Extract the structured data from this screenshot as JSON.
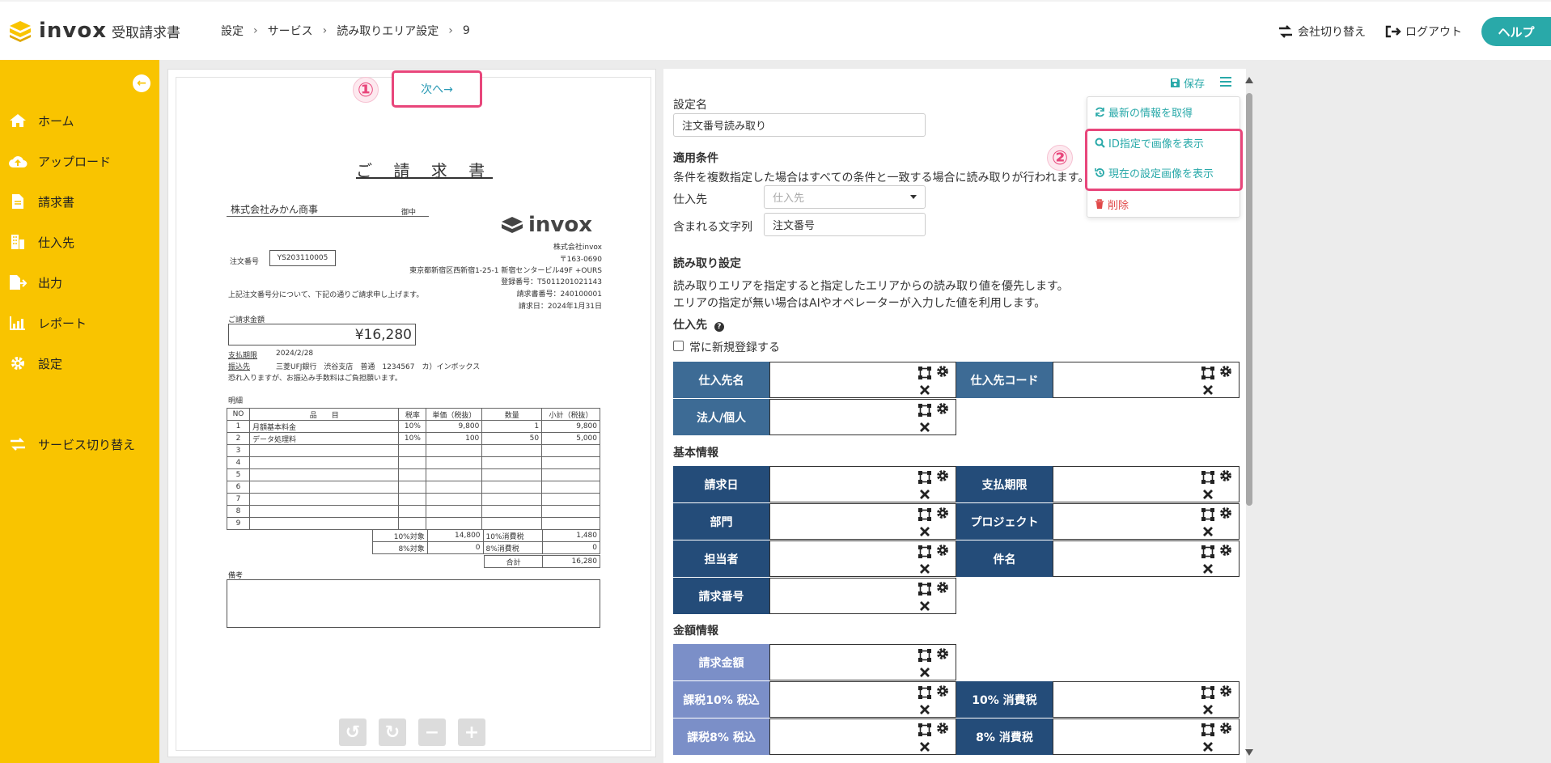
{
  "header": {
    "logo_text": "invox",
    "logo_sub": "受取請求書",
    "breadcrumb": [
      "設定",
      "サービス",
      "読み取りエリア設定",
      "9"
    ],
    "switch_company": "会社切り替え",
    "logout": "ログアウト",
    "help": "ヘルプ"
  },
  "sidebar": {
    "items": [
      {
        "label": "ホーム",
        "icon": "home-icon"
      },
      {
        "label": "アップロード",
        "icon": "cloud-upload-icon"
      },
      {
        "label": "請求書",
        "icon": "document-icon"
      },
      {
        "label": "仕入先",
        "icon": "building-icon"
      },
      {
        "label": "出力",
        "icon": "file-export-icon"
      },
      {
        "label": "レポート",
        "icon": "chart-icon"
      },
      {
        "label": "設定",
        "icon": "gear-icon"
      }
    ],
    "switch_service": "サービス切り替え"
  },
  "doc": {
    "next": "次へ→",
    "marker1": "①",
    "marker2": "②",
    "invoice": {
      "title": "ご 請 求 書",
      "customer": "株式会社みかん商事",
      "onchu": "御中",
      "brand": "invox",
      "company": "株式会社invox",
      "postal": "〒163-0690",
      "address": "東京都新宿区西新宿1-25-1 新宿センタービル49F +OURS",
      "reg_no": "登録番号：T5011201021143",
      "invoice_no": "請求書番号：240100001",
      "date": "請求日：2024年1月31日",
      "order_label": "注文番号",
      "order_no": "YS203110005",
      "message": "上記注文番号分について、下記の通りご請求申し上げます。",
      "amount_label": "ご請求金額",
      "amount": "¥16,280",
      "due_label": "支払期限",
      "due": "2024/2/28",
      "bank_label": "振込先",
      "bank": "三菱UFJ銀行　渋谷支店　普通　1234567　カ）インボックス",
      "fee_note": "恐れ入りますが、お振込み手数料はご負担願います。",
      "details_label": "明細",
      "table_header": [
        "NO",
        "品　　目",
        "税率",
        "単価（税抜）",
        "数量",
        "小計（税抜）"
      ],
      "rows": [
        [
          "1",
          "月額基本料金",
          "10%",
          "9,800",
          "1",
          "9,800"
        ],
        [
          "2",
          "データ処理料",
          "10%",
          "100",
          "50",
          "5,000"
        ],
        [
          "3",
          "",
          "",
          "",
          "",
          ""
        ],
        [
          "4",
          "",
          "",
          "",
          "",
          ""
        ],
        [
          "5",
          "",
          "",
          "",
          "",
          ""
        ],
        [
          "6",
          "",
          "",
          "",
          "",
          ""
        ],
        [
          "7",
          "",
          "",
          "",
          "",
          ""
        ],
        [
          "8",
          "",
          "",
          "",
          "",
          ""
        ],
        [
          "9",
          "",
          "",
          "",
          "",
          ""
        ]
      ],
      "summary": [
        [
          "10%対象",
          "14,800",
          "10%消費税",
          "1,480"
        ],
        [
          "8%対象",
          "0",
          "8%消費税",
          "0"
        ]
      ],
      "total_label": "合計",
      "total": "16,280",
      "remarks_label": "備考"
    }
  },
  "form": {
    "save": "保存",
    "setting_name_label": "設定名",
    "setting_name_value": "注文番号読み取り",
    "apply_cond_label": "適用条件",
    "apply_cond_desc": "条件を複数指定した場合はすべての条件と一致する場合に読み取りが行われます。",
    "supplier_label": "仕入先",
    "supplier_placeholder": "仕入先",
    "contains_label": "含まれる文字列",
    "contains_value": "注文番号",
    "read_settings_label": "読み取り設定",
    "read_desc1": "読み取りエリアを指定すると指定したエリアからの読み取り値を優先します。",
    "read_desc2": "エリアの指定が無い場合はAIやオペレーターが入力した値を利用します。",
    "supplier_section": "仕入先",
    "always_register": "常に新規登録する",
    "basic_section": "基本情報",
    "amount_section": "金額情報",
    "fields": {
      "supplier_name": "仕入先名",
      "supplier_code": "仕入先コード",
      "entity": "法人/個人",
      "invoice_date": "請求日",
      "due_date": "支払期限",
      "department": "部門",
      "project": "プロジェクト",
      "person": "担当者",
      "subject": "件名",
      "invoice_no": "請求番号",
      "invoice_amount": "請求金額",
      "taxed10": "課税10% 税込",
      "tax10": "10% 消費税",
      "taxed8": "課税8% 税込",
      "tax8": "8% 消費税"
    },
    "menu": {
      "refresh": "最新の情報を取得",
      "show_by_id": "ID指定で画像を表示",
      "show_current": "現在の設定画像を表示",
      "delete": "削除"
    }
  },
  "colors": {
    "sidebar": "#f9c400",
    "accent": "#29a9a9",
    "highlight": "#e8467b",
    "supplier_field": "#3d6b95",
    "basic_field": "#244c79",
    "amount_field": "#7b8fc8"
  }
}
